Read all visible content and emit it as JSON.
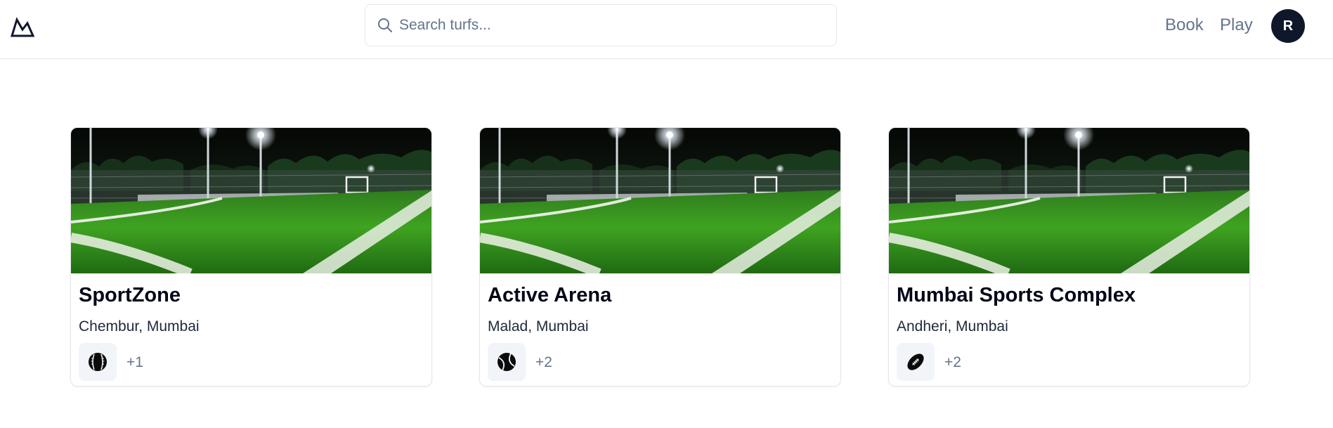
{
  "header": {
    "logo_icon": "mountain-logo-icon",
    "search": {
      "placeholder": "Search turfs...",
      "value": "",
      "icon": "search-icon"
    },
    "nav": {
      "book_label": "Book",
      "play_label": "Play"
    },
    "avatar_initial": "R"
  },
  "turfs": [
    {
      "name": "SportZone",
      "location": "Chembur, Mumbai",
      "sport_icon": "cricket-ball-icon",
      "extra_sports": "+1"
    },
    {
      "name": "Active Arena",
      "location": "Malad, Mumbai",
      "sport_icon": "tennis-ball-icon",
      "extra_sports": "+2"
    },
    {
      "name": "Mumbai Sports Complex",
      "location": "Andheri, Mumbai",
      "sport_icon": "football-icon",
      "extra_sports": "+2"
    }
  ],
  "colors": {
    "primary": "#0f172a",
    "muted_text": "#64748b",
    "border": "#e5e7eb",
    "badge_bg": "#f1f5f9",
    "turf_green": "#2e8b1f"
  }
}
